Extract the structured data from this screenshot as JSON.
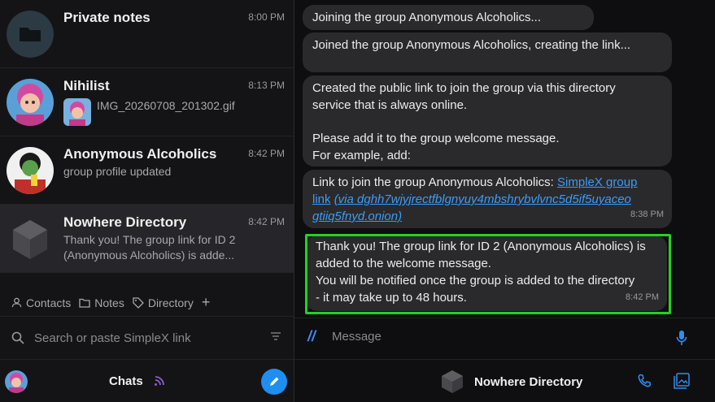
{
  "chats": [
    {
      "name": "Private notes",
      "time": "8:00 PM",
      "preview": "",
      "avatar_icon": "folder-icon"
    },
    {
      "name": "Nihilist",
      "time": "8:13 PM",
      "preview": "IMG_20260708_201302.gif",
      "avatar_icon": "cartoon-avatar"
    },
    {
      "name": "Anonymous Alcoholics",
      "time": "8:42 PM",
      "preview": "group profile updated",
      "avatar_icon": "cartoon-avatar"
    },
    {
      "name": "Nowhere Directory",
      "time": "8:42 PM",
      "preview": "Thank you! The group link for ID 2 (Anonymous Alcoholics) is adde...",
      "avatar_icon": "cube-icon"
    }
  ],
  "filters": {
    "contacts": "Contacts",
    "notes": "Notes",
    "directory": "Directory",
    "add": "+"
  },
  "search": {
    "placeholder": "Search or paste SimpleX link"
  },
  "bottom": {
    "chats_label": "Chats"
  },
  "messages": {
    "m1": "Joining the group Anonymous Alcoholics...",
    "m2": "Joined the group Anonymous Alcoholics, creating the link...",
    "m3_line1": "Created the public link to join the group via this directory",
    "m3_line2": "service that is always online.",
    "m3_line3": "Please add it to the group welcome message.",
    "m3_line4": "For example, add:",
    "m4_prefix": "Link to join the group Anonymous Alcoholics: ",
    "m4_link": "SimpleX group",
    "m4_link2": "link",
    "m4_link_italic": "(via dghh7wjyjrectfblgnyuy4mbshrybvlvnc5d5if5uyaceo",
    "m4_link3": "gtiiq5fnyd.onion)",
    "m4_time": "8:38 PM",
    "m5_line1": "Thank you! The group link for ID 2 (Anonymous Alcoholics) is",
    "m5_line2": "added to the welcome message.",
    "m5_line3": "You will be notified once the group is added to the directory",
    "m5_line4": "- it may take up to 48 hours.",
    "m5_time": "8:42 PM"
  },
  "composer": {
    "placeholder": "Message"
  },
  "header": {
    "title": "Nowhere Directory"
  },
  "colors": {
    "accent": "#1f8ef1",
    "highlight": "#22d322",
    "bubble": "#2a2a2d"
  }
}
